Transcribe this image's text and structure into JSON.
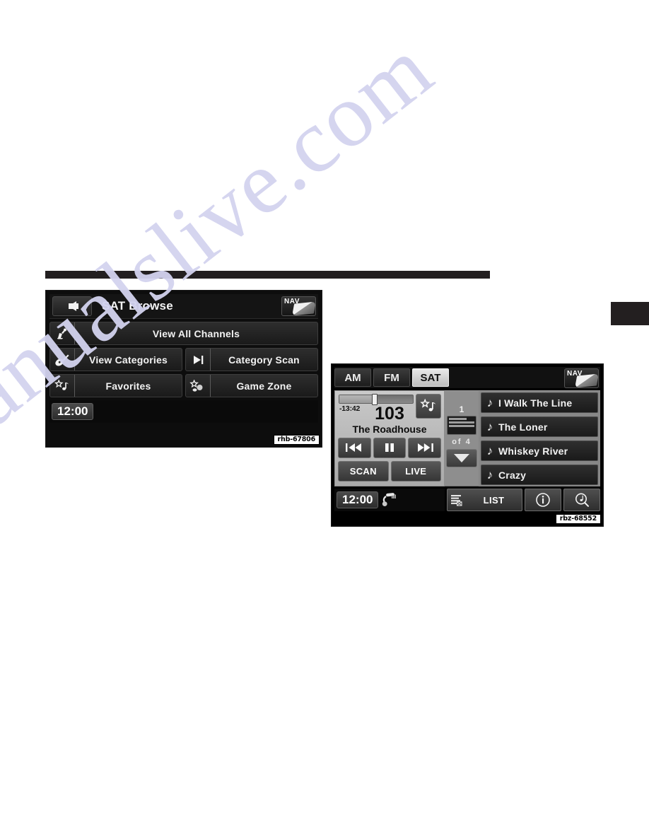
{
  "page": {
    "watermark": "manualslive.com"
  },
  "browse_screen": {
    "caption": "rhb-67806",
    "header": {
      "title": "SAT Browse",
      "back_icon": "back-arrow-icon",
      "nav_label": "NAV"
    },
    "buttons": [
      {
        "label": "View All Channels",
        "icon": "satellite-dish-icon",
        "layout": "full"
      },
      {
        "label": "View Categories",
        "icon": "guitar-icon",
        "layout": "half"
      },
      {
        "label": "Category Scan",
        "icon": "skip-forward-icon",
        "layout": "half"
      },
      {
        "label": "Favorites",
        "icon": "star-note-icon",
        "layout": "half"
      },
      {
        "label": "Game Zone",
        "icon": "star-sports-icon",
        "layout": "half"
      }
    ],
    "footer": {
      "clock": "12:00"
    }
  },
  "player_screen": {
    "caption": "rbz-68552",
    "tabs": [
      {
        "label": "AM",
        "active": false
      },
      {
        "label": "FM",
        "active": false
      },
      {
        "label": "SAT",
        "active": true
      }
    ],
    "nav_label": "NAV",
    "now_playing": {
      "elapsed": "-13:42",
      "progress_percent": 46,
      "channel_number": "103",
      "channel_name": "The Roadhouse",
      "favorite_icon": "star-note-icon",
      "transport": [
        {
          "icon": "previous-track-icon",
          "name": "previous-button"
        },
        {
          "icon": "pause-icon",
          "name": "pause-button"
        },
        {
          "icon": "next-track-icon",
          "name": "next-button"
        }
      ],
      "scan_label": "SCAN",
      "live_label": "LIVE"
    },
    "paging": {
      "current": "1",
      "of_label": "of",
      "total": "4",
      "thumb_icon": "list-page-icon",
      "down_icon": "chevron-down-icon"
    },
    "song_list": [
      {
        "title": "I Walk The Line",
        "icon": "music-note-icon"
      },
      {
        "title": "The Loner",
        "icon": "music-note-icon"
      },
      {
        "title": "Whiskey River",
        "icon": "music-note-icon"
      },
      {
        "title": "Crazy",
        "icon": "music-note-icon"
      }
    ],
    "footer": {
      "clock": "12:00",
      "phone_icon": "phone-handset-icon",
      "list_label": "LIST",
      "list_icon": "list-lines-icon",
      "info_icon": "info-circle-icon",
      "search_icon": "music-search-icon"
    }
  }
}
